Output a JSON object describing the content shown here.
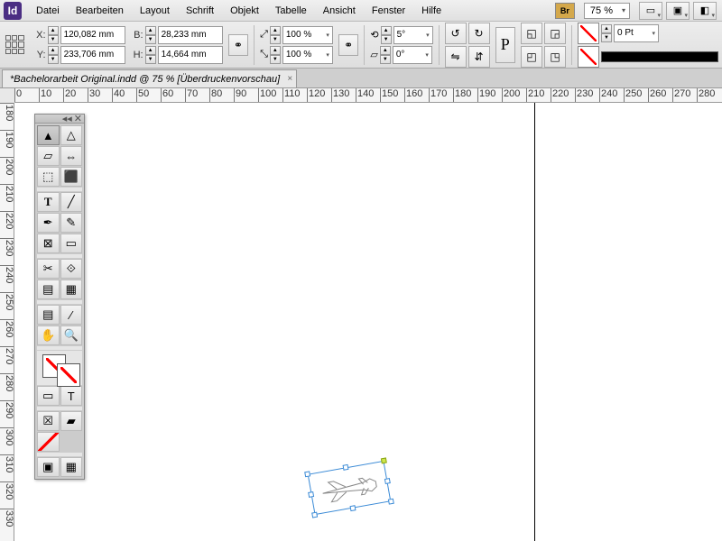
{
  "app_abbrev": "Id",
  "menu": [
    "Datei",
    "Bearbeiten",
    "Layout",
    "Schrift",
    "Objekt",
    "Tabelle",
    "Ansicht",
    "Fenster",
    "Hilfe"
  ],
  "bridge_label": "Br",
  "zoom_display": "75 %",
  "transform": {
    "x_label": "X:",
    "x": "120,082 mm",
    "y_label": "Y:",
    "y": "233,706 mm",
    "w_label": "B:",
    "w": "28,233 mm",
    "h_label": "H:",
    "h": "14,664 mm"
  },
  "scale": {
    "x": "100 %",
    "y": "100 %"
  },
  "rotate": "5°",
  "shear": "0°",
  "stroke_weight": "0 Pt",
  "document_tab": "*Bachelorarbeit Original.indd @ 75 % [Überdruckenvorschau]",
  "ruler_h": [
    0,
    10,
    20,
    30,
    40,
    50,
    60,
    70,
    80,
    90,
    100,
    110,
    120,
    130,
    140,
    150,
    160,
    170,
    180,
    190,
    200,
    210,
    220,
    230,
    240,
    250,
    260,
    270,
    280
  ],
  "ruler_v": [
    180,
    190,
    200,
    210,
    220,
    230,
    240,
    250,
    260,
    270,
    280,
    290,
    300,
    310,
    320,
    330
  ]
}
